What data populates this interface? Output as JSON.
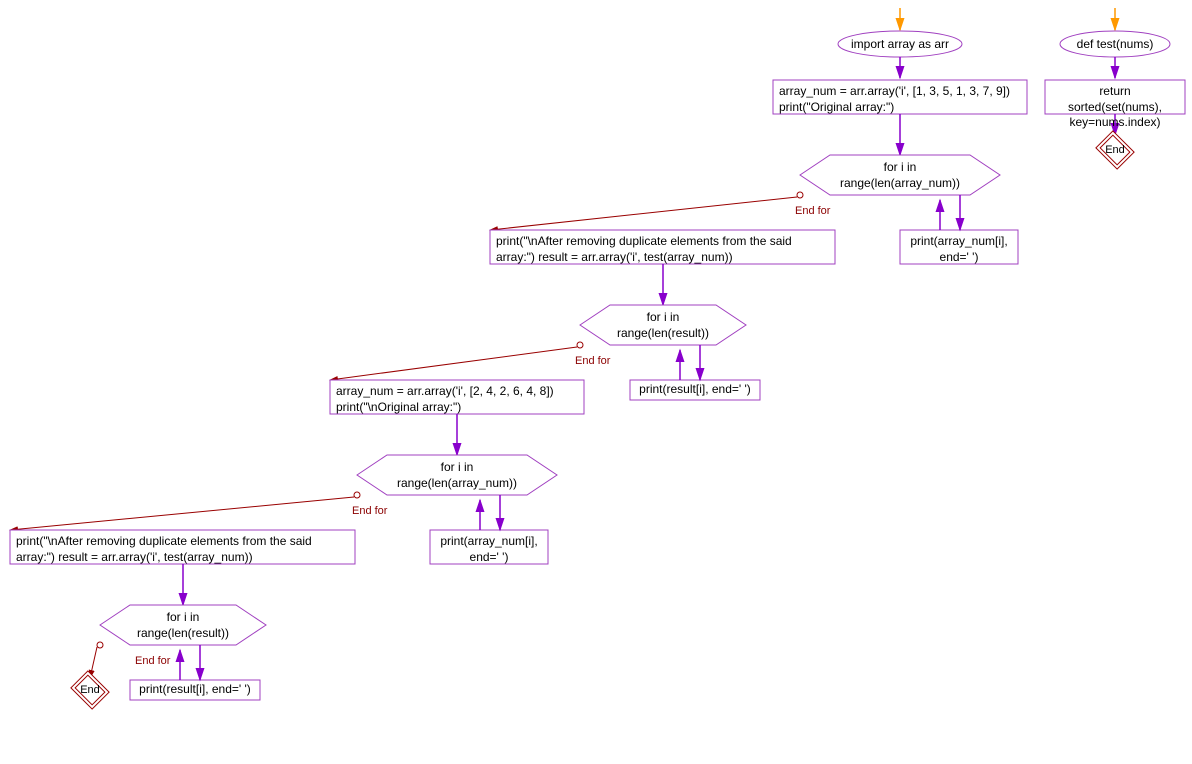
{
  "chart_data": {
    "type": "flowchart",
    "main": {
      "start_arrow": true,
      "import": "import array as arr",
      "block1": "array_num = arr.array('i', [1, 3, 5, 1, 3, 7, 9])\nprint(\"Original array:\")",
      "loop1": {
        "condition": "for i in\nrange(len(array_num))",
        "body": "print(array_num[i],\nend=' ')",
        "exit_label": "End for"
      },
      "block2": "print(\"\\nAfter removing duplicate elements from the said array:\")\nresult = arr.array('i', test(array_num))",
      "loop2": {
        "condition": "for i in\nrange(len(result))",
        "body": "print(result[i], end=' ')",
        "exit_label": "End for"
      },
      "block3": "array_num = arr.array('i', [2, 4, 2, 6, 4, 8])\nprint(\"\\nOriginal array:\")",
      "loop3": {
        "condition": "for i in\nrange(len(array_num))",
        "body": "print(array_num[i],\nend=' ')",
        "exit_label": "End for"
      },
      "block4": "print(\"\\nAfter removing duplicate elements from the said array:\")\nresult = arr.array('i', test(array_num))",
      "loop4": {
        "condition": "for i in\nrange(len(result))",
        "body": "print(result[i], end=' ')",
        "exit_label": "End for"
      },
      "end": "End"
    },
    "func": {
      "start_arrow": true,
      "def": "def test(nums)",
      "body": "return sorted(set(nums),\nkey=nums.index)",
      "end": "End"
    }
  }
}
